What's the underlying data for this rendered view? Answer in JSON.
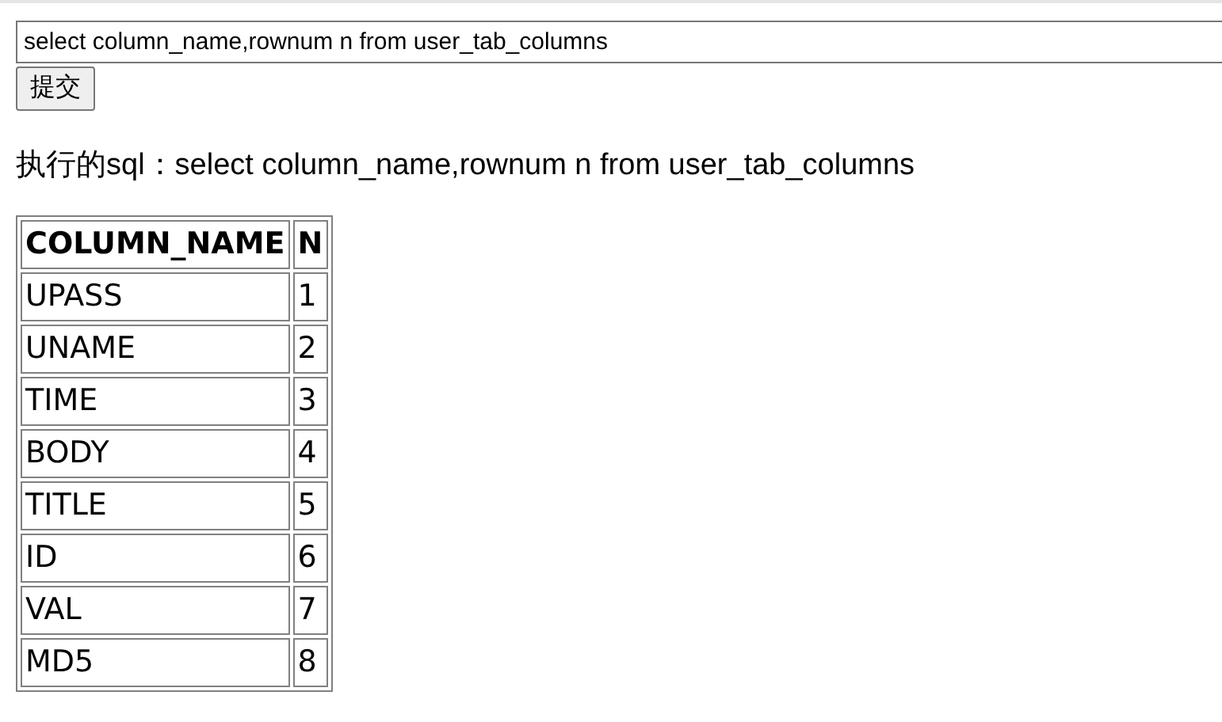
{
  "query_field": {
    "value": "select column_name,rownum n from user_tab_columns"
  },
  "submit_button": {
    "label": "提交"
  },
  "executed_sql": "执行的sql：select column_name,rownum n from user_tab_columns",
  "table": {
    "columns": [
      "COLUMN_NAME",
      "N"
    ],
    "rows": [
      [
        "UPASS",
        "1"
      ],
      [
        "UNAME",
        "2"
      ],
      [
        "TIME",
        "3"
      ],
      [
        "BODY",
        "4"
      ],
      [
        "TITLE",
        "5"
      ],
      [
        "ID",
        "6"
      ],
      [
        "VAL",
        "7"
      ],
      [
        "MD5",
        "8"
      ]
    ]
  }
}
